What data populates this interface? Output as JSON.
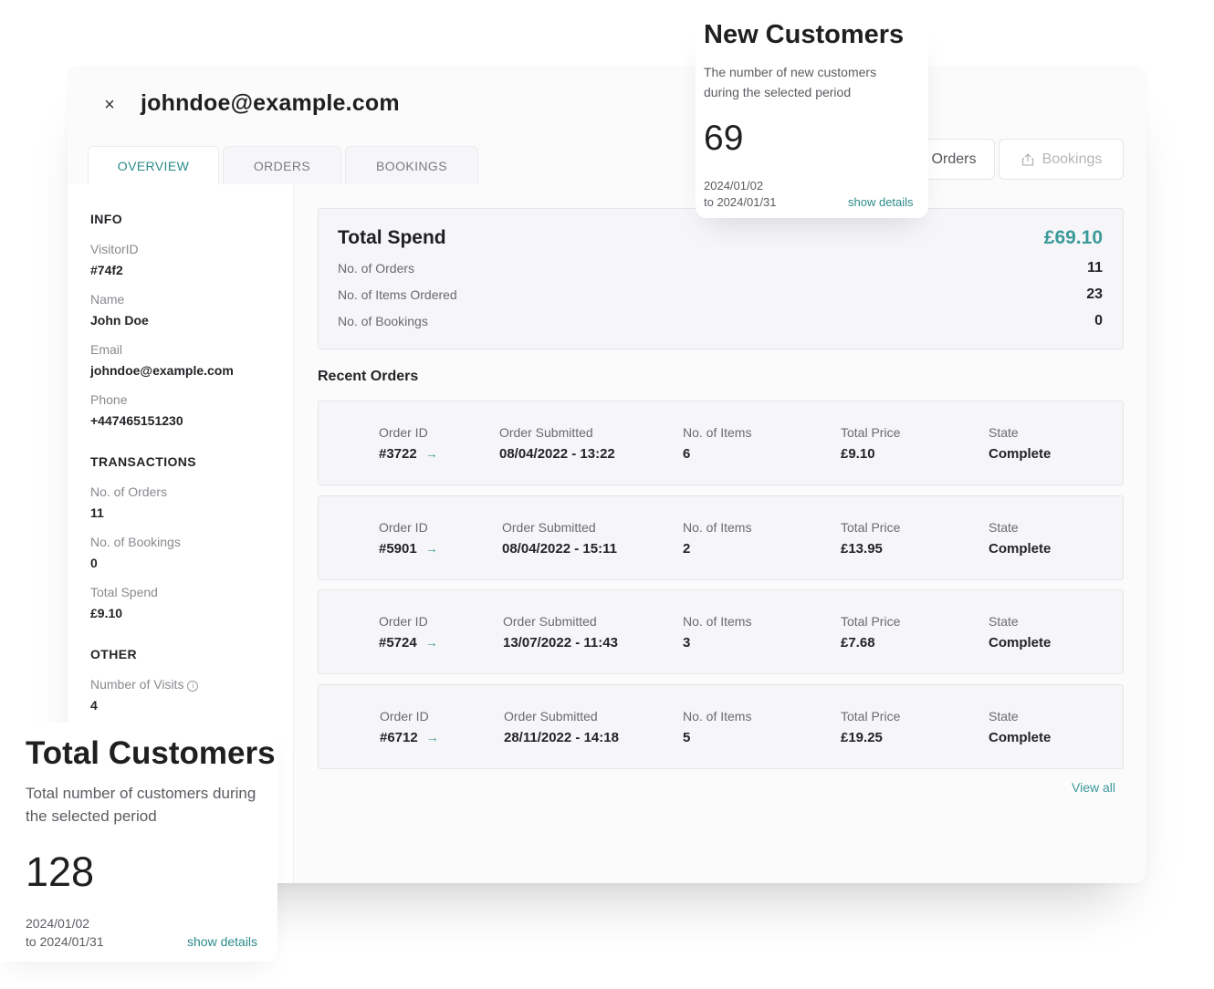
{
  "header": {
    "title": "johndoe@example.com",
    "close_icon": "×"
  },
  "tabs": [
    {
      "label": "OVERVIEW",
      "active": true
    },
    {
      "label": "ORDERS",
      "active": false
    },
    {
      "label": "BOOKINGS",
      "active": false
    }
  ],
  "toolbar": {
    "orders_label": "Orders",
    "bookings_label": "Bookings",
    "bookings_icon": "share-icon"
  },
  "sidebar": {
    "info_heading": "INFO",
    "visitor_id_label": "VisitorID",
    "visitor_id_value": "#74f2",
    "name_label": "Name",
    "name_value": "John Doe",
    "email_label": "Email",
    "email_value": "johndoe@example.com",
    "phone_label": "Phone",
    "phone_value": "+447465151230",
    "transactions_heading": "TRANSACTIONS",
    "orders_label": "No. of Orders",
    "orders_value": "11",
    "bookings_label": "No. of Bookings",
    "bookings_value": "0",
    "spend_label": "Total Spend",
    "spend_value": "£9.10",
    "other_heading": "OTHER",
    "visits_label": "Number of Visits",
    "visits_value": "4"
  },
  "spend": {
    "title": "Total Spend",
    "amount": "£69.10",
    "orders_label": "No. of Orders",
    "orders_value": "11",
    "items_label": "No. of Items Ordered",
    "items_value": "23",
    "bookings_label": "No. of Bookings",
    "bookings_value": "0",
    "accent_color": "#3c9a9a"
  },
  "recent": {
    "title": "Recent Orders",
    "labels": {
      "id": "Order ID",
      "submitted": "Order Submitted",
      "items": "No. of Items",
      "price": "Total Price",
      "state": "State"
    },
    "orders": [
      {
        "id": "#3722",
        "submitted": "08/04/2022 - 13:22",
        "items": "6",
        "price": "£9.10",
        "state": "Complete"
      },
      {
        "id": "#5901",
        "submitted": "08/04/2022 - 15:11",
        "items": "2",
        "price": "£13.95",
        "state": "Complete"
      },
      {
        "id": "#5724",
        "submitted": "13/07/2022 - 11:43",
        "items": "3",
        "price": "£7.68",
        "state": "Complete"
      },
      {
        "id": "#6712",
        "submitted": "28/11/2022 - 14:18",
        "items": "5",
        "price": "£19.25",
        "state": "Complete"
      }
    ],
    "view_all": "View all"
  },
  "new_customers": {
    "title": "New Customers",
    "description": "The number of new customers during the selected period",
    "value": "69",
    "date_from": "2024/01/02",
    "date_to": "to 2024/01/31",
    "link": "show details"
  },
  "total_customers": {
    "title": "Total Customers",
    "description": "Total number of customers during the selected period",
    "value": "128",
    "date_from": "2024/01/02",
    "date_to": "to 2024/01/31",
    "link": "show details"
  }
}
